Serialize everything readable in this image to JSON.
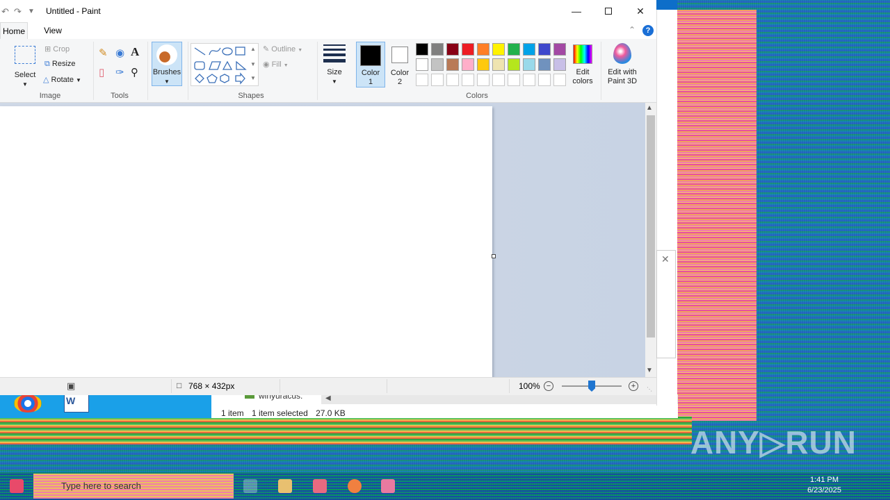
{
  "window": {
    "title": "Untitled - Paint"
  },
  "tabs": [
    {
      "label": "Home"
    },
    {
      "label": "View"
    }
  ],
  "ribbon": {
    "image": {
      "group_label": "Image",
      "select_label": "Select",
      "crop_label": "Crop",
      "resize_label": "Resize",
      "rotate_label": "Rotate"
    },
    "tools": {
      "group_label": "Tools"
    },
    "brushes": {
      "label": "Brushes"
    },
    "shapes": {
      "group_label": "Shapes",
      "outline_label": "Outline",
      "fill_label": "Fill"
    },
    "size": {
      "label": "Size"
    },
    "color1": {
      "label": "Color 1"
    },
    "color2": {
      "label": "Color 2"
    },
    "colors": {
      "group_label": "Colors"
    },
    "edit_colors": {
      "label": "Edit colors"
    },
    "paint3d": {
      "label": "Edit with Paint 3D"
    },
    "palette_row1": [
      "#000000",
      "#7f7f7f",
      "#880015",
      "#ed1c24",
      "#ff7f27",
      "#fff200",
      "#22b14c",
      "#00a2e8",
      "#3f48cc",
      "#a349a4"
    ],
    "palette_row2": [
      "#ffffff",
      "#c3c3c3",
      "#b97a57",
      "#ffaec9",
      "#ffc90e",
      "#efe4b0",
      "#b5e61d",
      "#99d9ea",
      "#7092be",
      "#c8bfe7"
    ]
  },
  "statusbar": {
    "dimensions": "768 × 432px",
    "zoom": "100%"
  },
  "explorer": {
    "items_count": "1 item",
    "selected": "1 item selected",
    "size": "27.0 KB",
    "file_name": "winyuracus."
  },
  "taskbar": {
    "search_placeholder": "Type here to search",
    "time": "1:41 PM",
    "date": "6/23/2025"
  },
  "watermark": "ANY▷RUN"
}
